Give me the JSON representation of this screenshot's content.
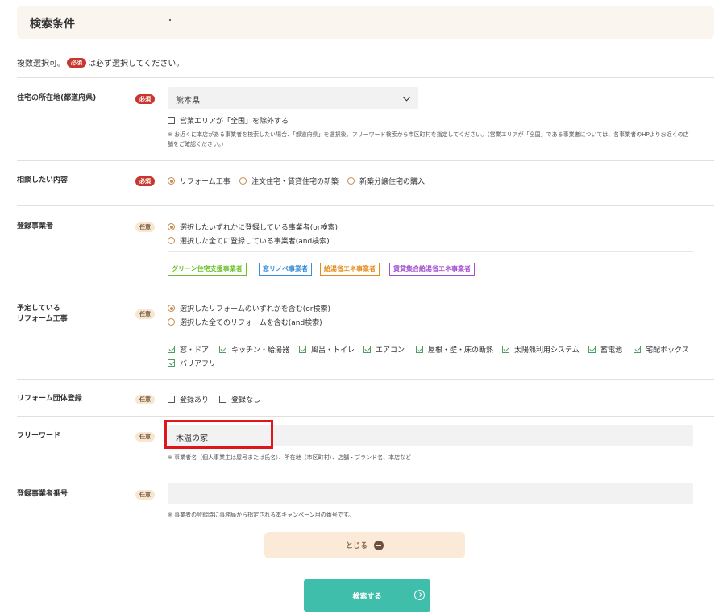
{
  "header": {
    "title": "検索条件"
  },
  "intro": {
    "prefix": "複数選択可。",
    "badge": "必須",
    "suffix": "は必ず選択してください。"
  },
  "badges": {
    "required": "必須",
    "optional": "任意"
  },
  "prefecture": {
    "label": "住宅の所在地(都道府県)",
    "selected": "熊本県",
    "exclude_label": "営業エリアが「全国」を除外する",
    "note": "※ お近くに本店がある事業者を検索したい場合、「都道府県」を選択後、フリーワード検索から市区町村を指定してください。（営業エリアが「全国」である事業者については、各事業者のHPよりお近くの店舗をご確認ください。）"
  },
  "consult": {
    "label": "相談したい内容",
    "options": [
      "リフォーム工事",
      "注文住宅・賃貸住宅の新築",
      "新築分譲住宅の購入"
    ]
  },
  "registered": {
    "label": "登録事業者",
    "options": [
      "選択したいずれかに登録している事業者(or検索)",
      "選択した全てに登録している事業者(and検索)"
    ],
    "tags": [
      {
        "label": "グリーン住宅支援事業者",
        "color": "#6bbf2a"
      },
      {
        "label": "窓リノベ事業者",
        "color": "#3b8fd9"
      },
      {
        "label": "給湯省エネ事業者",
        "color": "#e38b1d"
      },
      {
        "label": "賃貸集合給湯省エネ事業者",
        "color": "#a24fcf"
      }
    ]
  },
  "planned": {
    "label_line1": "予定している",
    "label_line2": "リフォーム工事",
    "options": [
      "選択したリフォームのいずれかを含む(or検索)",
      "選択した全てのリフォームを含む(and検索)"
    ],
    "items": [
      "窓・ドア",
      "キッチン・給湯器",
      "風呂・トイレ",
      "エアコン",
      "屋根・壁・床の断熱",
      "太陽熱利用システム",
      "蓄電池",
      "宅配ボックス",
      "バリアフリー"
    ]
  },
  "group": {
    "label": "リフォーム団体登録",
    "options": [
      "登録あり",
      "登録なし"
    ]
  },
  "freeword": {
    "label": "フリーワード",
    "value": "木温の家",
    "note": "※ 事業者名（個人事業主は屋号または氏名）、所在地（市区町村）、店舗・ブランド名、本店など"
  },
  "regnumber": {
    "label": "登録事業者番号",
    "value": "",
    "note": "※ 事業者の登録時に事務局から指定される本キャンペーン用の番号です。"
  },
  "buttons": {
    "close": "とじる",
    "search": "検索する"
  }
}
